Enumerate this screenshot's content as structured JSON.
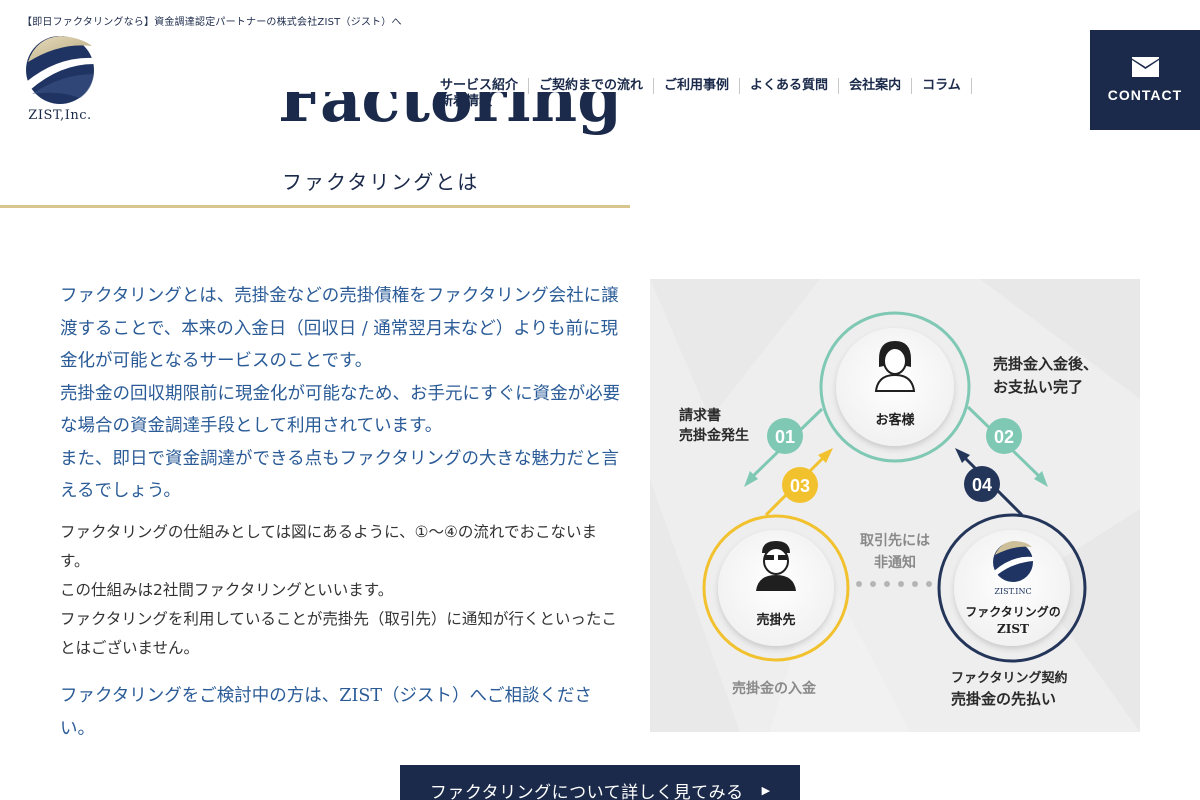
{
  "header": {
    "tagline": "【即日ファクタリングなら】資金調達認定パートナーの株式会社ZIST（ジスト）へ",
    "logo_text": "ZIST,Inc.",
    "nav": [
      "サービス紹介",
      "ご契約までの流れ",
      "ご利用事例",
      "よくある質問",
      "会社案内",
      "コラム",
      "新着情報"
    ],
    "contact_label": "CONTACT"
  },
  "hero": {
    "title": "Factoring",
    "subtitle": "ファクタリングとは"
  },
  "content": {
    "lead_paragraphs": [
      "ファクタリングとは、売掛金などの売掛債権をファクタリング会社に譲渡することで、本来の入金日（回収日 / 通常翌月末など）よりも前に現金化が可能となるサービスのことです。",
      "売掛金の回収期限前に現金化が可能なため、お手元にすぐに資金が必要な場合の資金調達手段として利用されています。",
      "また、即日で資金調達ができる点もファクタリングの大きな魅力だと言えるでしょう。"
    ],
    "body_paragraphs": [
      "ファクタリングの仕組みとしては図にあるように、①～④の流れでおこないます。",
      "この仕組みは2社間ファクタリングといいます。",
      "ファクタリングを利用していることが売掛先（取引先）に通知が行くといったことはございません。"
    ],
    "closing": "ファクタリングをご検討中の方は、ZIST（ジスト）へご相談ください。"
  },
  "diagram": {
    "customer_label": "お客様",
    "client_label": "売掛先",
    "zist_logo_text": "ZIST.INC",
    "zist_line1": "ファクタリングの",
    "zist_line2": "ZIST",
    "step_numbers": [
      "01",
      "02",
      "03",
      "04"
    ],
    "label_01_line1": "請求書",
    "label_01_line2": "売掛金発生",
    "label_02_line1": "売掛金入金後、",
    "label_02_line2": "お支払い完了",
    "label_03": "売掛金の入金",
    "label_04_line1": "ファクタリング契約",
    "label_04_line2": "売掛金の先払い",
    "notice_line1": "取引先には",
    "notice_line2": "非通知",
    "colors": {
      "teal": "#7ec8b4",
      "gold": "#f2c12e",
      "navy": "#24355a",
      "gray_text": "#8a8a8a"
    }
  },
  "cta": {
    "label": "ファクタリングについて詳しく見てみる",
    "arrow_icon": "chevron-right-icon"
  }
}
